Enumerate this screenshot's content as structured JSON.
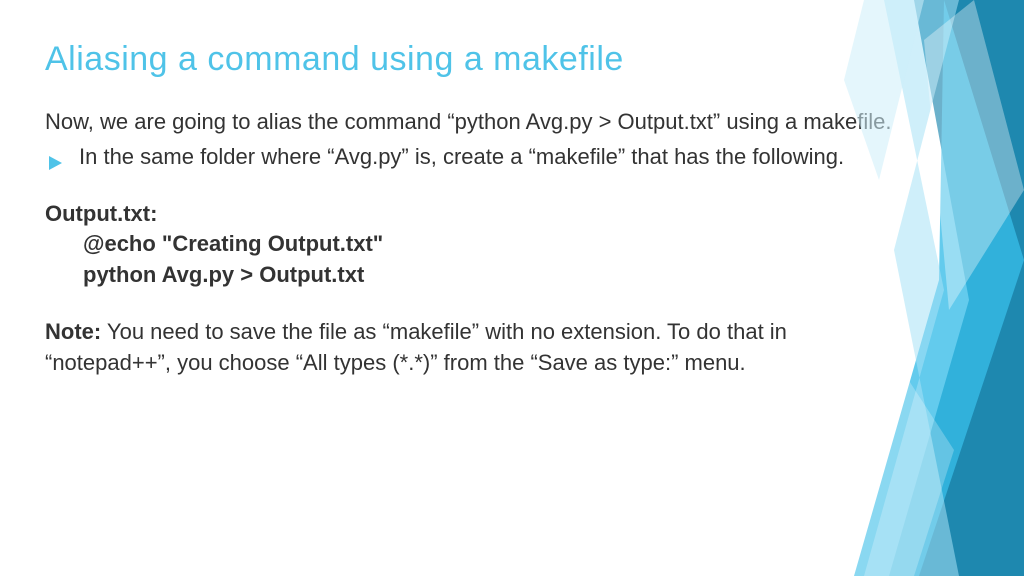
{
  "title": "Aliasing a command using  a makefile",
  "intro": "Now, we are going to alias the command “python Avg.py > Output.txt” using a makefile.",
  "bullet": "In the same folder where “Avg.py” is, create a “makefile” that has the following.",
  "code": {
    "line1": "Output.txt:",
    "line2": "@echo \"Creating Output.txt\"",
    "line3": "python Avg.py > Output.txt"
  },
  "note_label": "Note:",
  "note_text": " You need to save the file as “makefile” with no extension. To do that in “notepad++”, you choose “All types (*.*)” from the “Save as type:” menu."
}
